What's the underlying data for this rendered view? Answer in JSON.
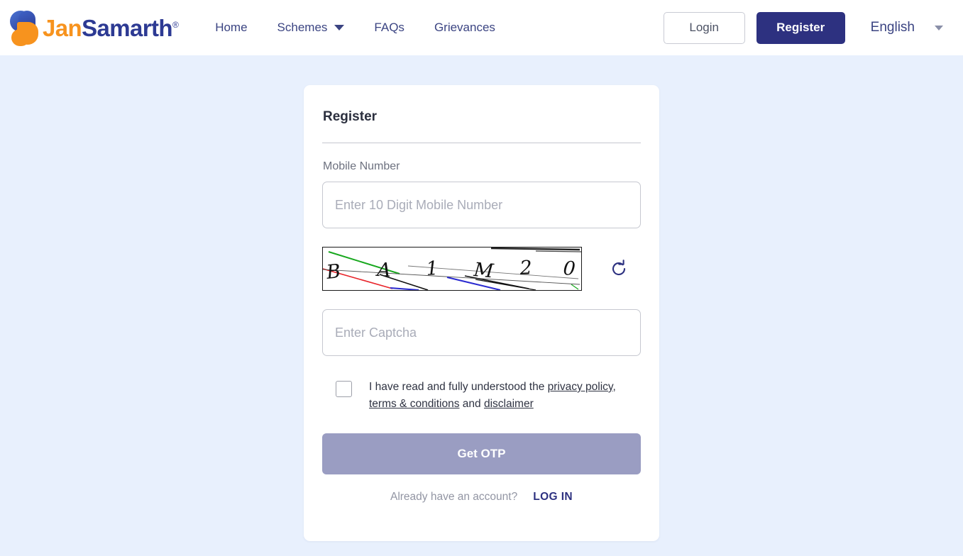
{
  "header": {
    "brand": {
      "name_part1": "Jan",
      "name_part2": "Samarth",
      "registered_mark": "®"
    },
    "nav": [
      {
        "label": "Home",
        "has_dropdown": false
      },
      {
        "label": "Schemes",
        "has_dropdown": true
      },
      {
        "label": "FAQs",
        "has_dropdown": false
      },
      {
        "label": "Grievances",
        "has_dropdown": false
      }
    ],
    "login_label": "Login",
    "register_label": "Register",
    "language": "English"
  },
  "card": {
    "title": "Register",
    "mobile_label": "Mobile Number",
    "mobile_placeholder": "Enter 10 Digit Mobile Number",
    "mobile_value": "",
    "captcha": {
      "text": "BA1M20",
      "characters": [
        "B",
        "A",
        "1",
        "M",
        "2",
        "0"
      ],
      "refresh_icon": "refresh-icon",
      "noise_colors": [
        "#18a81e",
        "#e8252b",
        "#2a2ad0",
        "#111111"
      ]
    },
    "captcha_placeholder": "Enter Captcha",
    "captcha_value": "",
    "consent": {
      "prefix": "I have read and fully understood the ",
      "link_privacy": "privacy policy",
      "separator1": ", ",
      "link_terms": "terms & conditions",
      "separator2": " and ",
      "link_disclaimer": "disclaimer",
      "checked": false
    },
    "submit_label": "Get OTP",
    "footer_note": "Already have an account?",
    "footer_link": "LOG IN"
  },
  "colors": {
    "page_background": "#e8f0fd",
    "brand_orange": "#f7931e",
    "brand_navy": "#2d3a93",
    "primary_navy": "#2d3180",
    "submit_disabled": "#9a9dc2"
  }
}
